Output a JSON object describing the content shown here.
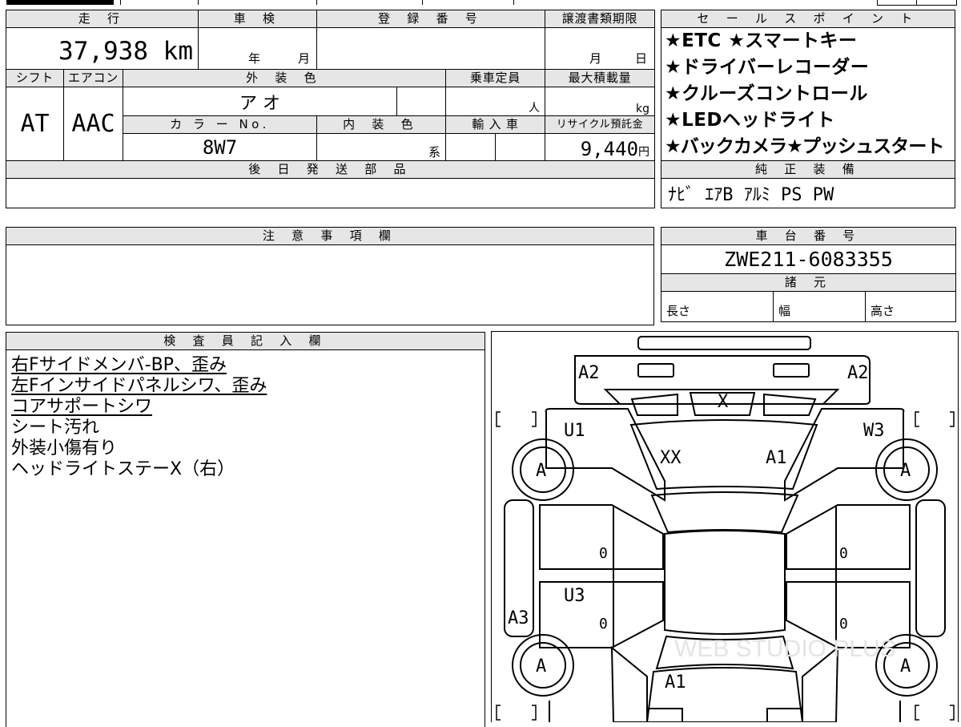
{
  "header": {
    "mileage_label": "走 行",
    "mileage_value": "37,938 km",
    "inspection_label": "車 検",
    "inspection_year": "年",
    "inspection_month": "月",
    "registration_label": "登 録 番 号",
    "deadline_label": "譲渡書類期限",
    "deadline_month": "月",
    "deadline_day": "日",
    "shift_label": "シフト",
    "shift_value": "AT",
    "aircon_label": "エアコン",
    "aircon_value": "AAC",
    "exterior_label": "外 装 色",
    "exterior_value": "ア オ",
    "capacity_label": "乗車定員",
    "capacity_unit": "人",
    "maxload_label": "最大積載量",
    "maxload_unit": "kg",
    "color_no_label": "カ ラ ー No.",
    "color_no_value": "8W7",
    "interior_label": "内 装 色",
    "interior_suffix": "系",
    "import_label": "輸 入 車",
    "recycle_label": "リサイクル預託金",
    "recycle_value": "9,440",
    "recycle_unit": "円",
    "parts_label": "後 日 発 送 部 品"
  },
  "sales": {
    "label": "セ ー ル ス ポ イ ン ト",
    "points": [
      "★ETC ★スマートキー",
      "★ドライバーレコーダー",
      "★クルーズコントロール",
      "★LEDヘッドライト",
      "★バックカメラ★プッシュスタート"
    ],
    "equipment_label": "純 正 装 備",
    "equipment_value": "ﾅﾋﾞ ｴｱB ｱﾙﾐ PS PW"
  },
  "notes": {
    "label": "注 意 事 項 欄"
  },
  "chassis": {
    "label": "車 台 番 号",
    "value": "ZWE211-6083355",
    "specs_label": "諸 元",
    "length_label": "長さ",
    "width_label": "幅",
    "height_label": "高さ"
  },
  "inspector": {
    "label": "検 査 員 記 入 欄",
    "lines": [
      {
        "text": "右Fサイドメンバ-BP、歪み",
        "underline": true
      },
      {
        "text": "左Fインサイドパネルシワ、歪み",
        "underline": true
      },
      {
        "text": "コアサポートシワ",
        "underline": true
      },
      {
        "text": "シート汚れ",
        "underline": false
      },
      {
        "text": "外装小傷有り",
        "underline": false
      },
      {
        "text": "ヘッドライトステーX（右）",
        "underline": false
      }
    ]
  },
  "diagram": {
    "marks": {
      "a2_left": "A2",
      "a2_right": "A2",
      "x_front": "X",
      "u1": "U1",
      "w3": "W3",
      "xx": "XX",
      "a1_hood": "A1",
      "wheel_fl": "A",
      "wheel_fr": "A",
      "zero_1": "0",
      "zero_2": "0",
      "zero_3": "0",
      "zero_4": "0",
      "u3": "U3",
      "a3": "A3",
      "wheel_rl": "A",
      "wheel_rr": "A",
      "a1_roof": "A1"
    },
    "watermark": "WEB STUDIO PLUS"
  }
}
